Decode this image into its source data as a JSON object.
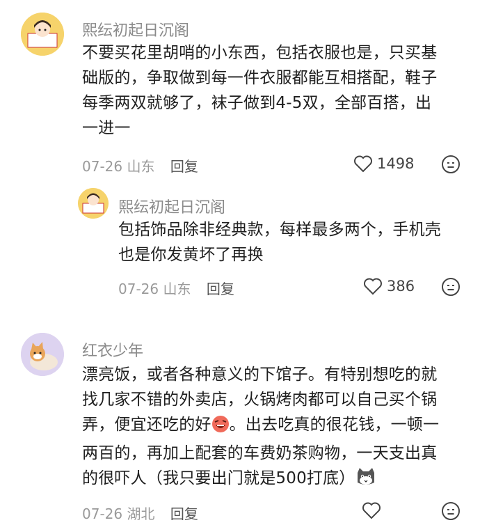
{
  "comments": [
    {
      "user": "熙纭初起日沉阁",
      "lines": [
        "不要买花里胡哨的小东西，包括衣服也是，只买基",
        "础版的，争取做到每一件衣服都能互相搭配，鞋子",
        "每季两双就够了，袜子做到4-5双，全部百搭，出",
        "一进一"
      ],
      "date": "07-26",
      "location": "山东",
      "reply_label": "回复",
      "likes": "1498"
    },
    {
      "user": "熙纭初起日沉阁",
      "lines": [
        "包括饰品除非经典款，每样最多两个，手机壳",
        "也是你发黄坏了再换"
      ],
      "date": "07-26",
      "location": "山东",
      "reply_label": "回复",
      "likes": "386"
    },
    {
      "user": "红衣少年",
      "lines": [
        "漂亮饭，或者各种意义的下馆子。有特别想吃的就",
        "找几家不错的外卖店，火锅烤肉都可以自己买个锅",
        "弄，便宜还吃的好",
        "。出去吃真的很花钱，一顿一",
        "两百的，再加上配套的车费奶茶购物，一天支出真",
        "的很吓人（我只要出门就是500打底）"
      ],
      "date": "07-26",
      "location": "湖北",
      "reply_label": "回复"
    }
  ],
  "icons": {
    "like": "heart-outline-icon",
    "dislike": "neutral-face-icon",
    "laugh_emoji": "laughing-face-emoji",
    "cat_emoji": "cat-face-emoji"
  }
}
